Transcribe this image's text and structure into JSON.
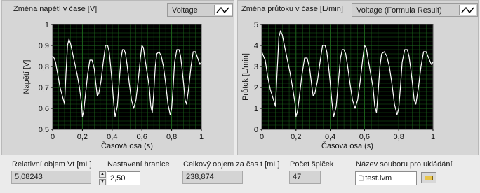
{
  "graphs": [
    {
      "title": "Změna napětí v čase [V]",
      "legend": "Voltage",
      "chart_data": {
        "type": "line",
        "xlabel": "Časová osa (s)",
        "ylabel": "Napětí [V]",
        "xlim": [
          0,
          1
        ],
        "ylim": [
          0.5,
          1
        ],
        "xticks": [
          "0",
          "0,2",
          "0,4",
          "0,6",
          "0,8",
          "1"
        ],
        "yticks": [
          "0,5",
          "0,6",
          "0,7",
          "0,8",
          "0,9",
          "1"
        ],
        "grid": true,
        "series": [
          {
            "x": [
              0,
              0.01,
              0.02,
              0.035,
              0.05,
              0.065,
              0.08,
              0.09,
              0.1,
              0.11,
              0.12,
              0.135,
              0.15,
              0.165,
              0.18,
              0.195,
              0.2,
              0.21,
              0.22,
              0.235,
              0.25,
              0.265,
              0.28,
              0.29,
              0.3,
              0.31,
              0.325,
              0.34,
              0.355,
              0.37,
              0.38,
              0.39,
              0.4,
              0.41,
              0.42,
              0.435,
              0.45,
              0.46,
              0.47,
              0.48,
              0.49,
              0.5,
              0.515,
              0.53,
              0.545,
              0.56,
              0.575,
              0.59,
              0.6,
              0.61,
              0.62,
              0.635,
              0.65,
              0.66,
              0.67,
              0.68,
              0.69,
              0.7,
              0.715,
              0.73,
              0.745,
              0.76,
              0.775,
              0.79,
              0.8,
              0.81,
              0.82,
              0.835,
              0.85,
              0.86,
              0.87,
              0.88,
              0.89,
              0.9,
              0.915,
              0.93,
              0.945,
              0.96,
              0.975,
              0.99,
              1
            ],
            "y": [
              0.85,
              0.84,
              0.82,
              0.76,
              0.7,
              0.66,
              0.62,
              0.77,
              0.9,
              0.93,
              0.91,
              0.86,
              0.81,
              0.76,
              0.7,
              0.62,
              0.56,
              0.59,
              0.66,
              0.76,
              0.83,
              0.83,
              0.79,
              0.72,
              0.66,
              0.67,
              0.73,
              0.82,
              0.9,
              0.9,
              0.87,
              0.8,
              0.72,
              0.63,
              0.56,
              0.61,
              0.75,
              0.84,
              0.88,
              0.88,
              0.86,
              0.81,
              0.72,
              0.64,
              0.6,
              0.64,
              0.73,
              0.84,
              0.9,
              0.89,
              0.84,
              0.77,
              0.7,
              0.61,
              0.58,
              0.68,
              0.8,
              0.86,
              0.87,
              0.85,
              0.8,
              0.72,
              0.62,
              0.57,
              0.6,
              0.7,
              0.82,
              0.88,
              0.88,
              0.85,
              0.79,
              0.72,
              0.64,
              0.62,
              0.7,
              0.8,
              0.87,
              0.87,
              0.84,
              0.81,
              0.82
            ]
          }
        ]
      }
    },
    {
      "title": "Změna průtoku v čase [L/min]",
      "legend": "Voltage (Formula Result)",
      "chart_data": {
        "type": "line",
        "xlabel": "Časová osa (s)",
        "ylabel": "Průtok [L/min]",
        "xlim": [
          0,
          1
        ],
        "ylim": [
          0,
          5
        ],
        "xticks": [
          "0",
          "0,2",
          "0,4",
          "0,6",
          "0,8",
          "1"
        ],
        "yticks": [
          "0",
          "1",
          "2",
          "3",
          "4",
          "5"
        ],
        "grid": true,
        "series": [
          {
            "x": [
              0,
              0.01,
              0.02,
              0.035,
              0.05,
              0.065,
              0.08,
              0.09,
              0.1,
              0.11,
              0.12,
              0.135,
              0.15,
              0.165,
              0.18,
              0.195,
              0.2,
              0.21,
              0.22,
              0.235,
              0.25,
              0.265,
              0.28,
              0.29,
              0.3,
              0.31,
              0.325,
              0.34,
              0.355,
              0.37,
              0.38,
              0.39,
              0.4,
              0.41,
              0.42,
              0.435,
              0.45,
              0.46,
              0.47,
              0.48,
              0.49,
              0.5,
              0.515,
              0.53,
              0.545,
              0.56,
              0.575,
              0.59,
              0.6,
              0.61,
              0.62,
              0.635,
              0.65,
              0.66,
              0.67,
              0.68,
              0.69,
              0.7,
              0.715,
              0.73,
              0.745,
              0.76,
              0.775,
              0.79,
              0.8,
              0.81,
              0.82,
              0.835,
              0.85,
              0.86,
              0.87,
              0.88,
              0.89,
              0.9,
              0.915,
              0.93,
              0.945,
              0.96,
              0.975,
              0.99,
              1
            ],
            "y": [
              3.7,
              3.5,
              3.3,
              2.5,
              1.9,
              1.5,
              1.1,
              2.8,
              4.4,
              4.7,
              4.5,
              3.9,
              3.3,
              2.7,
              2.0,
              1.2,
              0.6,
              0.9,
              1.6,
              2.6,
              3.4,
              3.4,
              2.9,
              2.2,
              1.6,
              1.7,
              2.3,
              3.2,
              4.0,
              4.0,
              3.7,
              3.0,
              2.2,
              1.3,
              0.6,
              1.1,
              2.5,
              3.4,
              3.8,
              3.8,
              3.6,
              3.1,
              2.2,
              1.4,
              1.0,
              1.4,
              2.3,
              3.4,
              4.0,
              3.9,
              3.4,
              2.7,
              2.0,
              1.1,
              0.8,
              1.8,
              3.0,
              3.6,
              3.7,
              3.5,
              3.0,
              2.2,
              1.2,
              0.7,
              1.0,
              2.0,
              3.2,
              3.8,
              3.8,
              3.5,
              2.9,
              2.2,
              1.4,
              1.2,
              2.0,
              3.0,
              3.7,
              3.7,
              3.4,
              3.1,
              3.2
            ]
          }
        ]
      }
    }
  ],
  "fields": {
    "rel_volume_label": "Relativní objem Vt [mL]",
    "rel_volume_value": "5,08243",
    "threshold_label": "Nastavení hranice",
    "threshold_value": "2,50",
    "total_volume_label": "Celkový objem za čas t [mL]",
    "total_volume_value": "238,874",
    "peaks_label": "Počet špiček",
    "peaks_value": "47",
    "filename_label": "Název souboru pro ukládání",
    "filename_value": "test.lvm"
  },
  "colors": {
    "plot_bg": "#000000",
    "grid": "#1e6b1e",
    "trace": "#ffffff",
    "panel": "#d6d6d6"
  },
  "icons": {
    "spin": "increment-decrement-arrows",
    "path": "path-prefix-icon",
    "browse": "folder-icon"
  }
}
